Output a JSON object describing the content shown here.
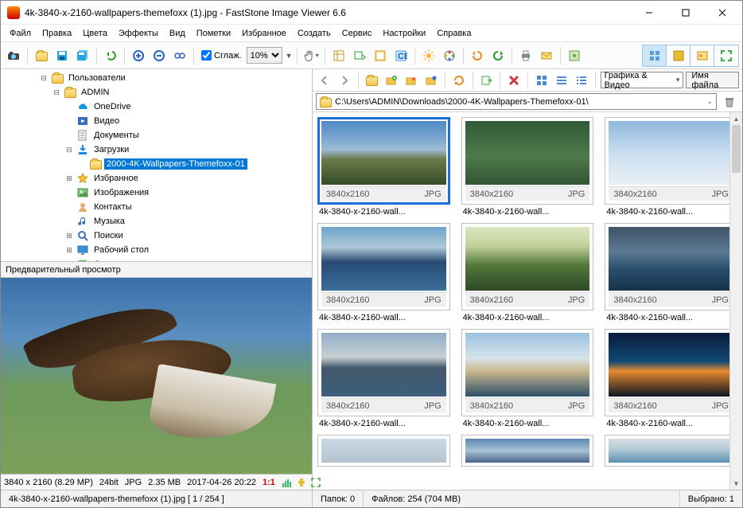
{
  "window": {
    "title": "4k-3840-x-2160-wallpapers-themefoxx (1).jpg  -  FastStone Image Viewer 6.6"
  },
  "menu": [
    "Файл",
    "Правка",
    "Цвета",
    "Эффекты",
    "Вид",
    "Пометки",
    "Избранное",
    "Создать",
    "Сервис",
    "Настройки",
    "Справка"
  ],
  "toolbar": {
    "smooth_label": "Сглаж.",
    "zoom_value": "10%",
    "zoom_options": [
      "10%"
    ]
  },
  "tree": [
    {
      "depth": 3,
      "exp": "-",
      "icon": "folder",
      "label": "Пользователи"
    },
    {
      "depth": 4,
      "exp": "-",
      "icon": "folder",
      "label": "ADMIN"
    },
    {
      "depth": 5,
      "exp": "",
      "icon": "onedrive",
      "label": "OneDrive"
    },
    {
      "depth": 5,
      "exp": "",
      "icon": "video",
      "label": "Видео"
    },
    {
      "depth": 5,
      "exp": "",
      "icon": "docs",
      "label": "Документы"
    },
    {
      "depth": 5,
      "exp": "-",
      "icon": "downloads",
      "label": "Загрузки"
    },
    {
      "depth": 6,
      "exp": "",
      "icon": "folder",
      "label": "2000-4K-Wallpapers-Themefoxx-01",
      "selected": true
    },
    {
      "depth": 5,
      "exp": "+",
      "icon": "fav",
      "label": "Избранное"
    },
    {
      "depth": 5,
      "exp": "",
      "icon": "pictures",
      "label": "Изображения"
    },
    {
      "depth": 5,
      "exp": "",
      "icon": "contacts",
      "label": "Контакты"
    },
    {
      "depth": 5,
      "exp": "",
      "icon": "music",
      "label": "Музыка"
    },
    {
      "depth": 5,
      "exp": "+",
      "icon": "search",
      "label": "Поиски"
    },
    {
      "depth": 5,
      "exp": "+",
      "icon": "desktop",
      "label": "Рабочий стол"
    },
    {
      "depth": 5,
      "exp": "",
      "icon": "saved",
      "label": "Сохраненные игры"
    }
  ],
  "preview": {
    "header": "Предварительный просмотр",
    "info": {
      "dims": "3840 x 2160 (8.29 MP)",
      "depth": "24bit",
      "format": "JPG",
      "size": "2.35 MB",
      "date": "2017-04-26 20:22",
      "ratio": "1:1"
    }
  },
  "right_toolbar": {
    "combo_label": "Графика & Видео",
    "name_btn": "Имя файла"
  },
  "path": "C:\\Users\\ADMIN\\Downloads\\2000-4K-Wallpapers-Themefoxx-01\\",
  "thumb_meta": {
    "res": "3840x2160",
    "fmt": "JPG"
  },
  "thumbs": [
    {
      "label": "4k-3840-x-2160-wall...",
      "g": 0,
      "selected": true
    },
    {
      "label": "4k-3840-x-2160-wall...",
      "g": 1
    },
    {
      "label": "4k-3840-x-2160-wall...",
      "g": 2
    },
    {
      "label": "4k-3840-x-2160-wall...",
      "g": 3
    },
    {
      "label": "4k-3840-x-2160-wall...",
      "g": 4
    },
    {
      "label": "4k-3840-x-2160-wall...",
      "g": 5
    },
    {
      "label": "4k-3840-x-2160-wall...",
      "g": 6
    },
    {
      "label": "4k-3840-x-2160-wall...",
      "g": 7
    },
    {
      "label": "4k-3840-x-2160-wall...",
      "g": 8
    },
    {
      "label": "",
      "g": 9
    },
    {
      "label": "",
      "g": 10
    },
    {
      "label": "",
      "g": 11
    }
  ],
  "status": {
    "filepos": "4k-3840-x-2160-wallpapers-themefoxx (1).jpg  [ 1 / 254 ]",
    "folders": "Папок: 0",
    "files": "Файлов: 254 (704 MB)",
    "selected": "Выбрано: 1"
  },
  "icon_colors": {
    "camera": "#2a8",
    "save": "#27a3e0",
    "saveall": "#27a3e0",
    "zoomin": "#2a64c8",
    "zoomout": "#2a64c8",
    "nav": "#777",
    "green": "#3bab3b",
    "yellow": "#e6bb2e",
    "red": "#d23a3a",
    "orange": "#e88b28",
    "blue": "#2a6fd0",
    "purple": "#9a4fc4"
  }
}
